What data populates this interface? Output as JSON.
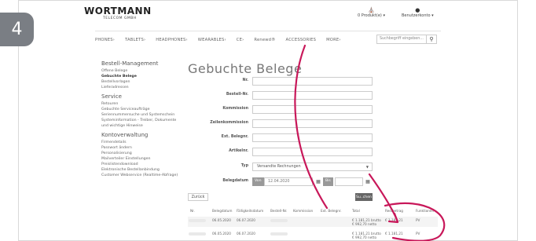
{
  "step_number": "4",
  "brand": {
    "name": "WORTMANN",
    "sub": "TELECOM GMBH"
  },
  "topbar": {
    "cart_label": "0 Produkt(e) ▾",
    "account_label": "Benutzerkonto ▾"
  },
  "nav": {
    "items": [
      "PHONES›",
      "TABLETS›",
      "HEADPHONES›",
      "WEARABLES›",
      "CE›",
      "Renewd®",
      "ACCESSORIES",
      "MORE›"
    ]
  },
  "search": {
    "placeholder": "Suchbegriff eingeben..."
  },
  "sidebar": {
    "groups": [
      {
        "title": "Bestell-Management",
        "items": [
          "Offene Belege",
          "Gebuchte Belege",
          "Bestellvorlagen",
          "Lieferadressen"
        ]
      },
      {
        "title": "Service",
        "items": [
          "Retouren",
          "Gebuchte Serviceaufträge",
          "Seriennummersuche und Systemschein",
          "Systeminformation - Treiber, Dokumente",
          "und wichtige Hinweise"
        ]
      },
      {
        "title": "Kontoverwaltung",
        "items": [
          "Firmendetails",
          "Passwort ändern",
          "Personalisierung",
          "Mailverteiler Einstellungen",
          "Preislistendownload",
          "Elektronische Bestellanbindung",
          "Customer Webservice (Realtime-Abfrage)"
        ]
      }
    ]
  },
  "page_title": "Gebuchte Belege",
  "form": {
    "nr": "Nr.",
    "bestell_nr": "Bestell-Nr.",
    "kommission": "Kommission",
    "zeilenkommission": "Zeilenkommission",
    "ext_belegnr": "Ext. Belegnr.",
    "artikelnr": "Artikelnr.",
    "typ_label": "Typ",
    "typ_value": "Versandte Rechnungen",
    "belegdatum_label": "Belegdatum",
    "von_label": "Von",
    "von_value": "12.04.2020",
    "bis_label": "Bis",
    "bis_value": ""
  },
  "buttons": {
    "back": "Zurück",
    "search": "Su..chen"
  },
  "table": {
    "headers": [
      "Nr.",
      "Belegdatum",
      "Fälligkeitsdatum",
      "Bestell-Nr.",
      "Kommission",
      "Ext. Belegnr.",
      "Total",
      "Restbetrag",
      "Funktionen"
    ],
    "rows": [
      {
        "belegdatum": "06.05.2020",
        "faellig": "06.07.2020",
        "total1": "€ 1.181,21 brutto",
        "total2": "€ 992,70 netto",
        "rest": "€ 1.181,21",
        "func": "PV"
      },
      {
        "belegdatum": "06.05.2020",
        "faellig": "06.07.2020",
        "total1": "€ 1.181,21 brutto",
        "total2": "€ 992,70 netto",
        "rest": "€ 1.181,21",
        "func": "PV"
      }
    ]
  },
  "colors": {
    "accent_arrow": "#c8185a",
    "badge": "#7a7e84"
  }
}
